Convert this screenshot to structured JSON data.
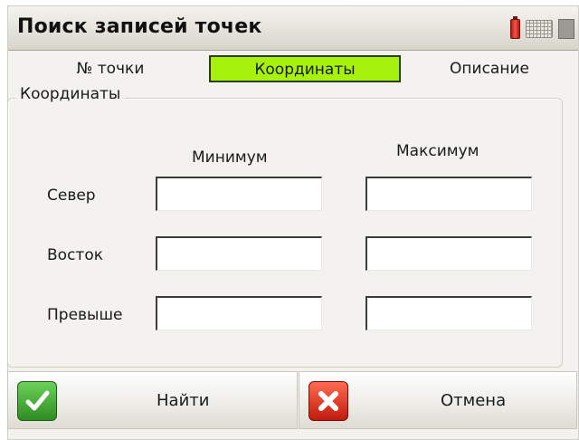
{
  "window": {
    "title": "Поиск записей точек"
  },
  "tray": {
    "icons": [
      "battery-icon",
      "keyboard-icon",
      "network-icon"
    ]
  },
  "tabs": [
    {
      "label": "№ точки",
      "active": false
    },
    {
      "label": "Координаты",
      "active": true
    },
    {
      "label": "Описание",
      "active": false
    }
  ],
  "group": {
    "legend": "Координаты",
    "min_header": "Минимум",
    "max_header": "Максимум",
    "rows": [
      {
        "label": "Север",
        "min": "",
        "max": ""
      },
      {
        "label": "Восток",
        "min": "",
        "max": ""
      },
      {
        "label": "Превыше",
        "min": "",
        "max": ""
      }
    ]
  },
  "buttons": {
    "find_label": "Найти",
    "cancel_label": "Отмена"
  },
  "colors": {
    "active_tab": "#a6f20d",
    "find_icon": "#3aa82c",
    "cancel_icon": "#d9261a"
  }
}
